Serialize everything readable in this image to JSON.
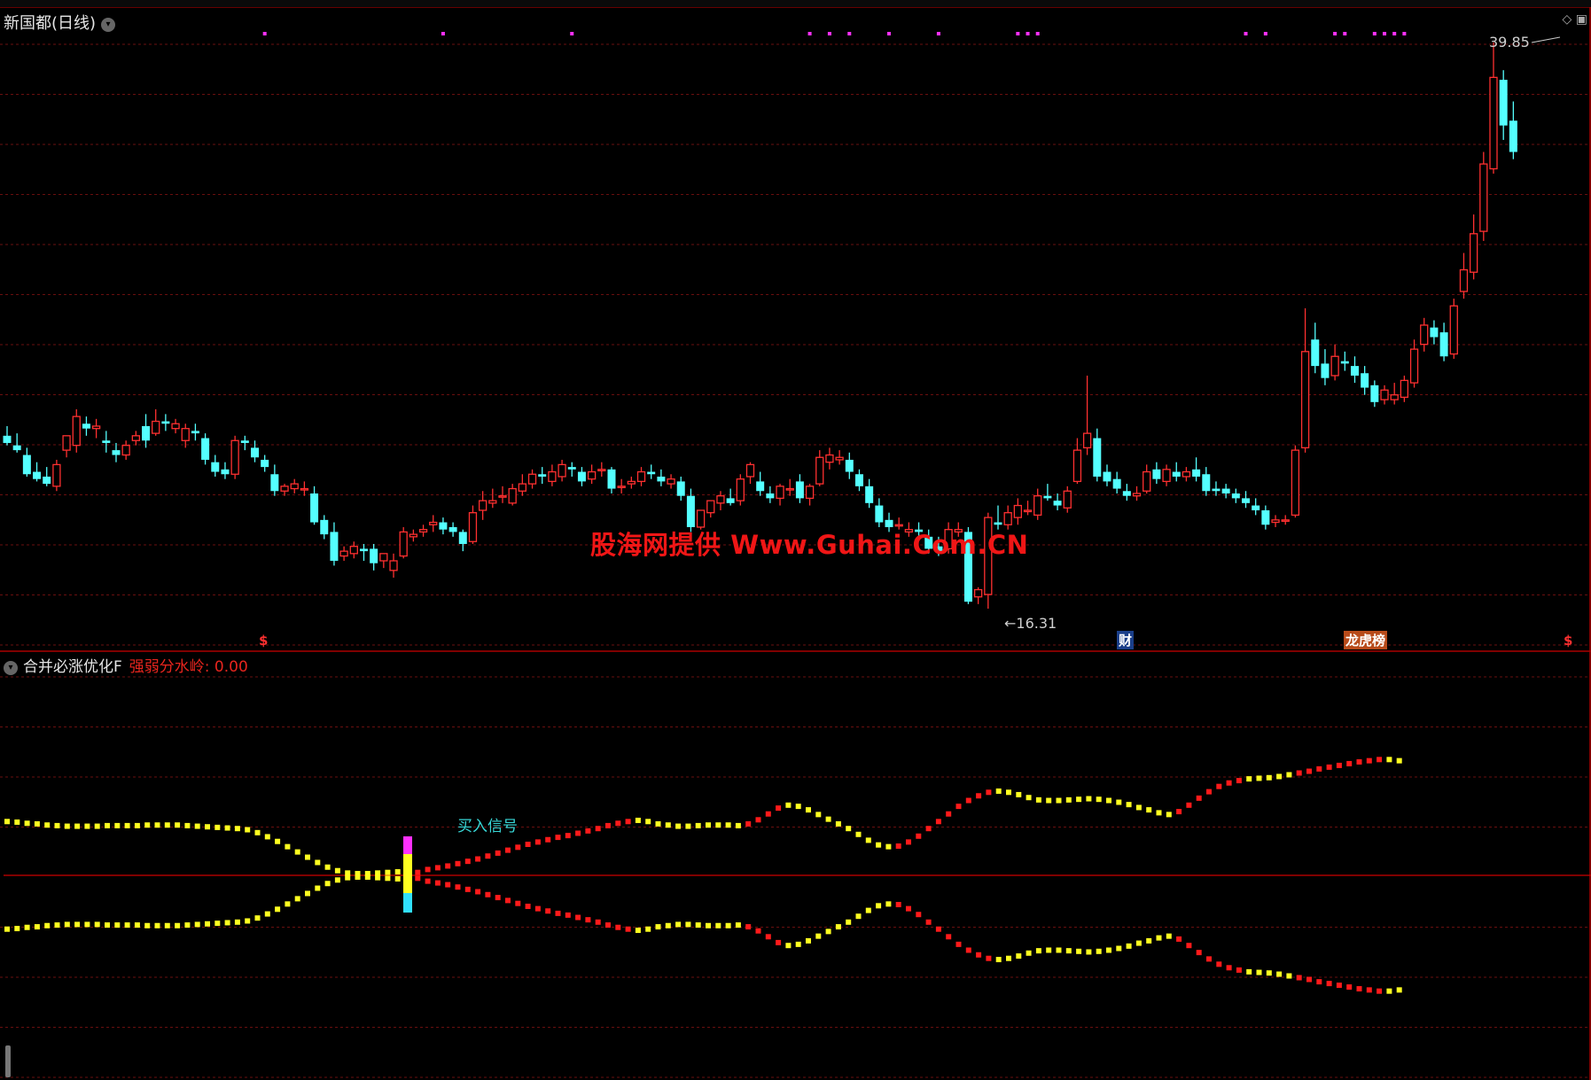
{
  "window": {
    "stock_title": "新国都(日线)",
    "indicator_title": "合并必涨优化F",
    "threshold_label": "强弱分水岭: 0.00",
    "watermark": "股海网提供 Www.Guhai.Com.CN",
    "high_label": "39.85",
    "low_label": "16.31",
    "buy_signal_label": "买入信号",
    "markers": {
      "dollar": "$",
      "cai": "财",
      "bang": "龙虎榜"
    },
    "icons": [
      "dropdown-icon",
      "diamond-icon",
      "window-icon"
    ]
  },
  "colors": {
    "up": "#ff3030",
    "down": "#54ffff",
    "grid": "#6a0f0f",
    "signal_dots": "#ff30ff",
    "line_yellow": "#ffff20",
    "line_red": "#ff1a1a",
    "zero_line": "#cc0000"
  },
  "chart_data": {
    "type": "candlestick",
    "title": "新国都(日线)",
    "price_high": 39.85,
    "price_low": 16.31,
    "candles": [
      [
        23.5,
        23.9,
        23.2,
        23.1
      ],
      [
        23.1,
        23.6,
        22.9,
        22.8
      ],
      [
        22.7,
        23.0,
        21.9,
        21.8
      ],
      [
        22.0,
        22.4,
        21.7,
        21.6
      ],
      [
        21.8,
        22.2,
        21.5,
        21.4
      ],
      [
        21.4,
        22.5,
        22.3,
        21.2
      ],
      [
        22.9,
        23.3,
        23.5,
        22.6
      ],
      [
        23.1,
        24.6,
        24.3,
        22.8
      ],
      [
        24.0,
        24.3,
        23.8,
        23.5
      ],
      [
        23.8,
        24.2,
        23.9,
        23.4
      ],
      [
        23.3,
        23.7,
        23.2,
        22.8
      ],
      [
        22.9,
        23.2,
        22.7,
        22.4
      ],
      [
        22.7,
        23.3,
        23.1,
        22.5
      ],
      [
        23.3,
        23.7,
        23.5,
        23.1
      ],
      [
        23.9,
        24.4,
        23.3,
        23.0
      ],
      [
        23.6,
        24.6,
        24.1,
        23.5
      ],
      [
        24.1,
        24.4,
        24.0,
        23.7
      ],
      [
        23.8,
        24.2,
        24.0,
        23.6
      ],
      [
        23.3,
        24.0,
        23.8,
        23.0
      ],
      [
        23.7,
        24.0,
        23.6,
        23.3
      ],
      [
        23.4,
        23.6,
        22.5,
        22.3
      ],
      [
        22.4,
        22.7,
        22.0,
        21.8
      ],
      [
        22.1,
        22.4,
        21.9,
        21.7
      ],
      [
        21.9,
        23.5,
        23.3,
        21.7
      ],
      [
        23.3,
        23.5,
        23.2,
        22.9
      ],
      [
        23.0,
        23.3,
        22.6,
        22.4
      ],
      [
        22.5,
        22.7,
        22.2,
        22.0
      ],
      [
        21.9,
        22.3,
        21.2,
        21.0
      ],
      [
        21.2,
        21.5,
        21.4,
        21.0
      ],
      [
        21.3,
        21.7,
        21.5,
        21.1
      ],
      [
        21.3,
        21.6,
        21.3,
        21.0
      ],
      [
        21.1,
        21.4,
        19.9,
        19.8
      ],
      [
        20.0,
        20.2,
        19.4,
        19.2
      ],
      [
        19.5,
        19.9,
        18.3,
        18.1
      ],
      [
        18.5,
        18.9,
        18.7,
        18.3
      ],
      [
        18.6,
        19.1,
        18.9,
        18.4
      ],
      [
        18.8,
        19.0,
        18.7,
        18.3
      ],
      [
        18.8,
        19.0,
        18.2,
        17.9
      ],
      [
        18.3,
        18.5,
        18.6,
        18.0
      ],
      [
        17.9,
        18.6,
        18.3,
        17.6
      ],
      [
        18.5,
        19.7,
        19.5,
        18.4
      ],
      [
        19.3,
        19.6,
        19.4,
        19.1
      ],
      [
        19.5,
        19.8,
        19.6,
        19.3
      ],
      [
        19.8,
        20.2,
        19.9,
        19.5
      ],
      [
        19.9,
        20.1,
        19.6,
        19.4
      ],
      [
        19.7,
        19.9,
        19.5,
        19.3
      ],
      [
        19.5,
        19.6,
        19.0,
        18.7
      ],
      [
        19.1,
        20.6,
        20.3,
        19.0
      ],
      [
        20.4,
        21.2,
        20.8,
        20.0
      ],
      [
        20.7,
        21.3,
        20.8,
        20.5
      ],
      [
        21.0,
        21.4,
        21.0,
        20.7
      ],
      [
        20.7,
        21.5,
        21.3,
        20.6
      ],
      [
        21.2,
        21.9,
        21.5,
        21.0
      ],
      [
        21.5,
        22.1,
        21.9,
        21.3
      ],
      [
        21.9,
        22.2,
        21.8,
        21.5
      ],
      [
        21.6,
        22.3,
        22.0,
        21.4
      ],
      [
        21.8,
        22.5,
        22.3,
        21.6
      ],
      [
        22.2,
        22.4,
        22.1,
        21.8
      ],
      [
        22.0,
        22.2,
        21.6,
        21.4
      ],
      [
        21.7,
        22.3,
        22.0,
        21.5
      ],
      [
        22.1,
        22.4,
        22.1,
        21.8
      ],
      [
        22.1,
        22.2,
        21.3,
        21.1
      ],
      [
        21.4,
        21.7,
        21.4,
        21.1
      ],
      [
        21.5,
        21.8,
        21.6,
        21.3
      ],
      [
        21.6,
        22.2,
        22.0,
        21.4
      ],
      [
        22.0,
        22.3,
        21.9,
        21.7
      ],
      [
        21.8,
        22.1,
        21.6,
        21.4
      ],
      [
        21.5,
        21.9,
        21.7,
        21.3
      ],
      [
        21.6,
        21.8,
        21.0,
        20.8
      ],
      [
        21.0,
        21.3,
        19.7,
        19.5
      ],
      [
        19.7,
        20.1,
        20.4,
        19.6
      ],
      [
        20.3,
        20.6,
        20.8,
        20.1
      ],
      [
        20.7,
        21.2,
        21.0,
        20.4
      ],
      [
        20.9,
        21.3,
        20.7,
        20.6
      ],
      [
        20.8,
        21.9,
        21.7,
        20.6
      ],
      [
        21.8,
        22.4,
        22.3,
        21.5
      ],
      [
        21.6,
        22.0,
        21.2,
        21.0
      ],
      [
        21.1,
        21.4,
        20.9,
        20.7
      ],
      [
        20.9,
        21.5,
        21.4,
        20.6
      ],
      [
        21.3,
        21.7,
        21.3,
        21.0
      ],
      [
        21.6,
        21.9,
        20.9,
        20.7
      ],
      [
        20.9,
        21.5,
        21.4,
        20.6
      ],
      [
        21.5,
        22.9,
        22.6,
        21.4
      ],
      [
        22.4,
        23.0,
        22.7,
        22.1
      ],
      [
        22.5,
        22.9,
        22.6,
        22.3
      ],
      [
        22.5,
        22.8,
        22.0,
        21.7
      ],
      [
        21.9,
        22.1,
        21.4,
        21.2
      ],
      [
        21.4,
        21.7,
        20.7,
        20.5
      ],
      [
        20.6,
        20.9,
        19.9,
        19.7
      ],
      [
        20.0,
        20.3,
        19.7,
        19.5
      ],
      [
        19.8,
        20.1,
        19.8,
        19.6
      ],
      [
        19.5,
        19.9,
        19.6,
        19.3
      ],
      [
        19.6,
        19.9,
        19.5,
        19.3
      ],
      [
        19.3,
        19.6,
        18.8,
        18.6
      ],
      [
        18.9,
        19.3,
        18.7,
        18.5
      ],
      [
        18.8,
        19.9,
        19.6,
        18.6
      ],
      [
        19.5,
        19.9,
        19.6,
        19.3
      ],
      [
        19.5,
        19.7,
        16.6,
        16.5
      ],
      [
        16.8,
        17.2,
        17.1,
        16.5
      ],
      [
        16.9,
        20.3,
        20.1,
        16.31
      ],
      [
        19.9,
        20.6,
        19.8,
        19.6
      ],
      [
        19.8,
        20.6,
        20.3,
        19.6
      ],
      [
        20.1,
        20.9,
        20.6,
        19.8
      ],
      [
        20.4,
        20.8,
        20.4,
        20.2
      ],
      [
        20.2,
        21.3,
        21.0,
        20.0
      ],
      [
        21.0,
        21.5,
        20.9,
        20.8
      ],
      [
        20.8,
        21.1,
        20.6,
        20.4
      ],
      [
        20.5,
        21.4,
        21.2,
        20.3
      ],
      [
        21.6,
        23.4,
        22.9,
        21.5
      ],
      [
        23.0,
        26.0,
        23.6,
        22.7
      ],
      [
        23.4,
        23.8,
        21.8,
        21.6
      ],
      [
        22.0,
        22.3,
        21.6,
        21.4
      ],
      [
        21.7,
        22.0,
        21.3,
        21.1
      ],
      [
        21.2,
        21.5,
        21.0,
        20.8
      ],
      [
        21.0,
        21.4,
        21.1,
        20.8
      ],
      [
        21.2,
        22.3,
        22.0,
        21.1
      ],
      [
        22.1,
        22.4,
        21.7,
        21.5
      ],
      [
        21.6,
        22.3,
        22.1,
        21.4
      ],
      [
        22.0,
        22.4,
        21.8,
        21.6
      ],
      [
        21.8,
        22.2,
        22.0,
        21.6
      ],
      [
        22.1,
        22.6,
        21.8,
        21.6
      ],
      [
        21.9,
        22.2,
        21.2,
        21.0
      ],
      [
        21.3,
        21.6,
        21.2,
        21.0
      ],
      [
        21.3,
        21.5,
        21.1,
        20.9
      ],
      [
        21.1,
        21.3,
        20.9,
        20.7
      ],
      [
        20.9,
        21.2,
        20.7,
        20.5
      ],
      [
        20.6,
        20.9,
        20.4,
        20.2
      ],
      [
        20.4,
        20.6,
        19.8,
        19.6
      ],
      [
        19.9,
        20.2,
        20.0,
        19.7
      ],
      [
        20.0,
        20.2,
        20.0,
        19.8
      ],
      [
        20.2,
        23.1,
        22.9,
        20.1
      ],
      [
        23.0,
        28.8,
        27.0,
        22.8
      ],
      [
        27.5,
        28.2,
        26.4,
        26.1
      ],
      [
        26.5,
        27.1,
        25.9,
        25.6
      ],
      [
        26.0,
        27.3,
        26.8,
        25.8
      ],
      [
        26.6,
        27.0,
        26.5,
        26.2
      ],
      [
        26.4,
        26.8,
        26.0,
        25.7
      ],
      [
        26.1,
        26.4,
        25.5,
        25.2
      ],
      [
        25.6,
        25.8,
        24.9,
        24.7
      ],
      [
        25.0,
        25.6,
        25.4,
        24.8
      ],
      [
        25.0,
        25.7,
        25.2,
        24.8
      ],
      [
        25.1,
        26.0,
        25.8,
        24.9
      ],
      [
        25.7,
        27.5,
        27.1,
        25.5
      ],
      [
        27.3,
        28.4,
        28.1,
        27.0
      ],
      [
        28.0,
        28.3,
        27.6,
        27.3
      ],
      [
        27.8,
        28.2,
        26.8,
        26.6
      ],
      [
        26.9,
        29.2,
        28.9,
        26.7
      ],
      [
        29.5,
        31.1,
        30.4,
        29.2
      ],
      [
        30.3,
        32.7,
        31.9,
        30.0
      ],
      [
        32.0,
        35.3,
        34.8,
        31.6
      ],
      [
        34.6,
        39.85,
        38.4,
        34.4
      ],
      [
        38.3,
        38.7,
        36.4,
        35.8
      ],
      [
        36.6,
        37.4,
        35.3,
        35.0
      ]
    ],
    "buy_signal_index": 40,
    "signal_dot_indices": [
      26,
      44,
      57,
      81,
      83,
      85,
      89,
      94,
      102,
      103,
      104,
      125,
      127,
      134,
      135,
      138,
      139,
      140,
      141
    ]
  },
  "indicator_data": {
    "upper": [
      [
        0.92,
        "y"
      ],
      [
        0.91,
        "y"
      ],
      [
        0.89,
        "y"
      ],
      [
        0.88,
        "y"
      ],
      [
        0.86,
        "y"
      ],
      [
        0.85,
        "y"
      ],
      [
        0.84,
        "y"
      ],
      [
        0.84,
        "y"
      ],
      [
        0.84,
        "y"
      ],
      [
        0.84,
        "y"
      ],
      [
        0.85,
        "y"
      ],
      [
        0.85,
        "y"
      ],
      [
        0.85,
        "y"
      ],
      [
        0.85,
        "y"
      ],
      [
        0.86,
        "y"
      ],
      [
        0.86,
        "y"
      ],
      [
        0.86,
        "y"
      ],
      [
        0.86,
        "y"
      ],
      [
        0.85,
        "y"
      ],
      [
        0.84,
        "y"
      ],
      [
        0.83,
        "y"
      ],
      [
        0.82,
        "y"
      ],
      [
        0.81,
        "y"
      ],
      [
        0.8,
        "y"
      ],
      [
        0.78,
        "y"
      ],
      [
        0.73,
        "y"
      ],
      [
        0.66,
        "y"
      ],
      [
        0.58,
        "y"
      ],
      [
        0.49,
        "y"
      ],
      [
        0.4,
        "y"
      ],
      [
        0.31,
        "y"
      ],
      [
        0.22,
        "y"
      ],
      [
        0.14,
        "y"
      ],
      [
        0.08,
        "y"
      ],
      [
        0.04,
        "y"
      ],
      [
        0.03,
        "y"
      ],
      [
        0.03,
        "y"
      ],
      [
        0.04,
        "y"
      ],
      [
        0.05,
        "y"
      ],
      [
        0.06,
        "y"
      ],
      [
        0.05,
        "y"
      ],
      [
        0.05,
        "r"
      ],
      [
        0.1,
        "r"
      ],
      [
        0.13,
        "r"
      ],
      [
        0.16,
        "r"
      ],
      [
        0.2,
        "r"
      ],
      [
        0.24,
        "r"
      ],
      [
        0.28,
        "r"
      ],
      [
        0.33,
        "r"
      ],
      [
        0.38,
        "r"
      ],
      [
        0.43,
        "r"
      ],
      [
        0.48,
        "r"
      ],
      [
        0.53,
        "r"
      ],
      [
        0.57,
        "r"
      ],
      [
        0.61,
        "r"
      ],
      [
        0.65,
        "r"
      ],
      [
        0.68,
        "r"
      ],
      [
        0.72,
        "r"
      ],
      [
        0.76,
        "r"
      ],
      [
        0.8,
        "r"
      ],
      [
        0.85,
        "r"
      ],
      [
        0.89,
        "r"
      ],
      [
        0.92,
        "r"
      ],
      [
        0.94,
        "y"
      ],
      [
        0.92,
        "y"
      ],
      [
        0.88,
        "y"
      ],
      [
        0.86,
        "y"
      ],
      [
        0.84,
        "y"
      ],
      [
        0.84,
        "y"
      ],
      [
        0.85,
        "y"
      ],
      [
        0.86,
        "y"
      ],
      [
        0.86,
        "y"
      ],
      [
        0.86,
        "y"
      ],
      [
        0.85,
        "y"
      ],
      [
        0.88,
        "r"
      ],
      [
        0.95,
        "r"
      ],
      [
        1.05,
        "r"
      ],
      [
        1.15,
        "r"
      ],
      [
        1.2,
        "y"
      ],
      [
        1.18,
        "y"
      ],
      [
        1.12,
        "y"
      ],
      [
        1.04,
        "y"
      ],
      [
        0.96,
        "y"
      ],
      [
        0.88,
        "y"
      ],
      [
        0.8,
        "y"
      ],
      [
        0.7,
        "y"
      ],
      [
        0.6,
        "y"
      ],
      [
        0.52,
        "y"
      ],
      [
        0.49,
        "y"
      ],
      [
        0.5,
        "r"
      ],
      [
        0.57,
        "r"
      ],
      [
        0.67,
        "r"
      ],
      [
        0.8,
        "r"
      ],
      [
        0.92,
        "r"
      ],
      [
        1.05,
        "r"
      ],
      [
        1.18,
        "r"
      ],
      [
        1.28,
        "r"
      ],
      [
        1.36,
        "r"
      ],
      [
        1.42,
        "r"
      ],
      [
        1.44,
        "y"
      ],
      [
        1.42,
        "y"
      ],
      [
        1.38,
        "y"
      ],
      [
        1.33,
        "y"
      ],
      [
        1.29,
        "y"
      ],
      [
        1.28,
        "y"
      ],
      [
        1.28,
        "y"
      ],
      [
        1.29,
        "y"
      ],
      [
        1.3,
        "y"
      ],
      [
        1.31,
        "y"
      ],
      [
        1.3,
        "y"
      ],
      [
        1.28,
        "y"
      ],
      [
        1.25,
        "y"
      ],
      [
        1.21,
        "y"
      ],
      [
        1.16,
        "y"
      ],
      [
        1.12,
        "y"
      ],
      [
        1.07,
        "y"
      ],
      [
        1.04,
        "y"
      ],
      [
        1.09,
        "r"
      ],
      [
        1.2,
        "r"
      ],
      [
        1.32,
        "r"
      ],
      [
        1.43,
        "r"
      ],
      [
        1.52,
        "r"
      ],
      [
        1.58,
        "r"
      ],
      [
        1.62,
        "r"
      ],
      [
        1.65,
        "y"
      ],
      [
        1.66,
        "y"
      ],
      [
        1.67,
        "y"
      ],
      [
        1.69,
        "y"
      ],
      [
        1.72,
        "y"
      ],
      [
        1.75,
        "r"
      ],
      [
        1.78,
        "r"
      ],
      [
        1.82,
        "r"
      ],
      [
        1.85,
        "r"
      ],
      [
        1.88,
        "r"
      ],
      [
        1.91,
        "r"
      ],
      [
        1.94,
        "r"
      ],
      [
        1.96,
        "r"
      ],
      [
        1.98,
        "r"
      ],
      [
        1.98,
        "y"
      ],
      [
        1.96,
        "y"
      ]
    ]
  }
}
